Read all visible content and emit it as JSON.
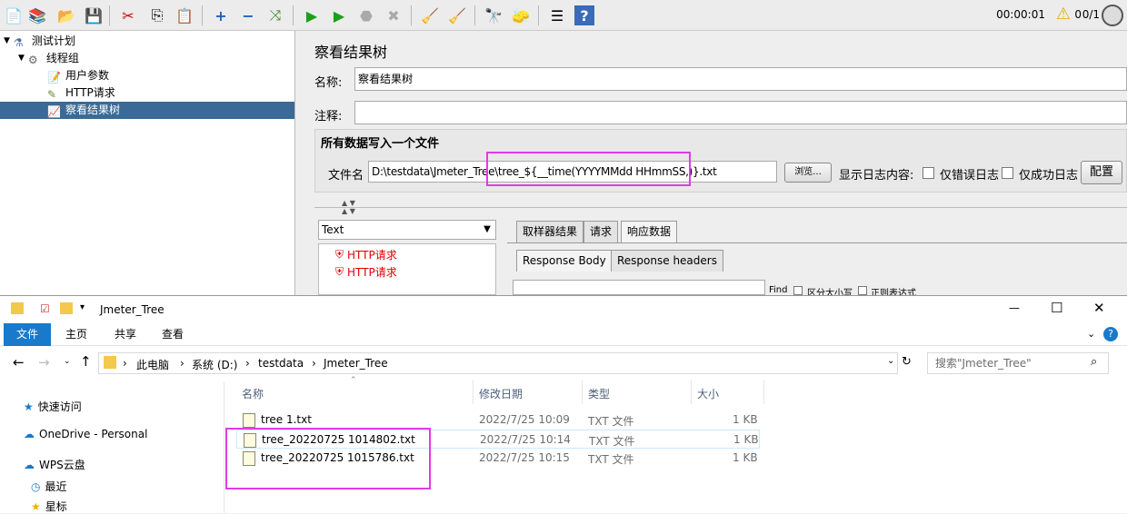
{
  "toolbar": {
    "icons": [
      "new-icon",
      "templates-icon",
      "open-icon",
      "save-icon",
      "cut-icon",
      "copy-icon",
      "paste-icon",
      "expand-icon",
      "collapse-icon",
      "toggle-icon",
      "start-icon",
      "start-no-pause-icon",
      "stop-icon",
      "shutdown-icon",
      "clear-icon",
      "clear-all-icon",
      "search-icon",
      "reset-search-icon",
      "function-helper-icon",
      "help-icon"
    ],
    "timer": "00:00:01",
    "warn_count": "0",
    "threads": "0/1"
  },
  "tree": {
    "items": [
      {
        "label": "测试计划",
        "icon": "test-plan-icon"
      },
      {
        "label": "线程组",
        "icon": "thread-group-icon"
      },
      {
        "label": "用户参数",
        "icon": "user-params-icon"
      },
      {
        "label": "HTTP请求",
        "icon": "http-request-icon"
      },
      {
        "label": "察看结果树",
        "icon": "view-results-tree-icon"
      }
    ]
  },
  "panel": {
    "title": "察看结果树",
    "name_label": "名称:",
    "name_value": "察看结果树",
    "comment_label": "注释:",
    "comment_value": "",
    "section_title": "所有数据写入一个文件",
    "filename_label": "文件名",
    "filename_value": "D:\\testdata\\Jmeter_Tree\\tree_${__time(YYYYMMdd HHmmSS,)}.txt",
    "browse_button": "浏览...",
    "log_label": "显示日志内容:",
    "errors_only": "仅错误日志",
    "success_only": "仅成功日志",
    "configure_button": "配置",
    "renderer_value": "Text",
    "results": [
      "HTTP请求",
      "HTTP请求"
    ],
    "tabs": [
      "取样器结果",
      "请求",
      "响应数据"
    ],
    "subtabs": [
      "Response Body",
      "Response headers"
    ],
    "find_label": "Find",
    "case_label": "区分大小写",
    "regex_label": "正则表达式"
  },
  "explorer": {
    "title": "Jmeter_Tree",
    "ribbon": [
      "文件",
      "主页",
      "共享",
      "查看"
    ],
    "breadcrumb": [
      "此电脑",
      "系统 (D:)",
      "testdata",
      "Jmeter_Tree"
    ],
    "search_placeholder": "搜索\"Jmeter_Tree\"",
    "nav": [
      "快速访问",
      "OneDrive - Personal",
      "WPS云盘",
      "最近",
      "星标"
    ],
    "columns": [
      "名称",
      "修改日期",
      "类型",
      "大小"
    ],
    "files": [
      {
        "name": "tree 1.txt",
        "date": "2022/7/25 10:09",
        "type": "TXT 文件",
        "size": "1 KB"
      },
      {
        "name": "tree_20220725 1014802.txt",
        "date": "2022/7/25 10:14",
        "type": "TXT 文件",
        "size": "1 KB"
      },
      {
        "name": "tree_20220725 1015786.txt",
        "date": "2022/7/25 10:15",
        "type": "TXT 文件",
        "size": "1 KB"
      }
    ],
    "colors": {
      "accent": "#1979ca",
      "highlight": "#e13be6"
    }
  }
}
